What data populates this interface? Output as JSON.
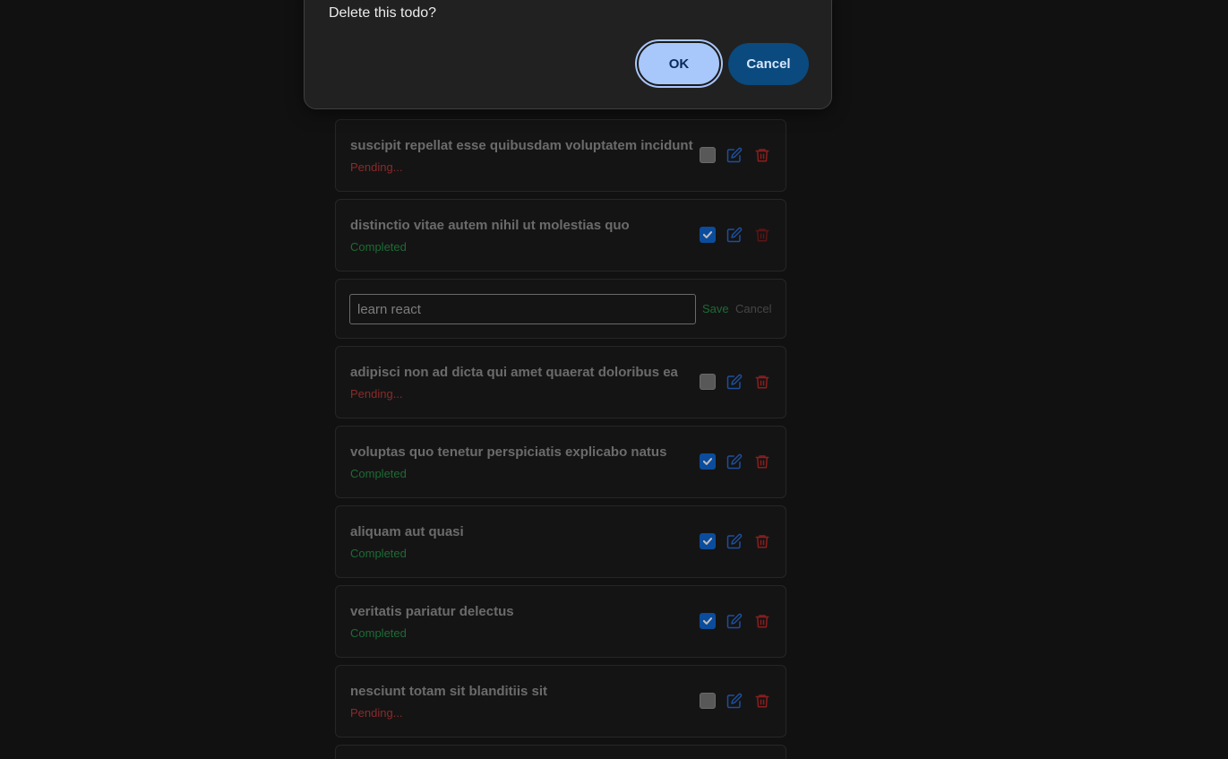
{
  "dialog": {
    "message": "Delete this todo?",
    "ok_label": "OK",
    "cancel_label": "Cancel"
  },
  "colors": {
    "background": "#111111",
    "pending": "#8b2a2a",
    "completed": "#1d6b35",
    "edit_icon": "#1e4f9c",
    "delete_icon": "#8b1e1e",
    "checkbox_checked": "#0b4c9c",
    "dialog_ok": "#a8c7fa",
    "dialog_cancel": "#0a4a7e"
  },
  "icons": {
    "checkbox_checked": "check-icon",
    "edit": "edit-icon",
    "delete": "trash-icon"
  },
  "todos": [
    {
      "title": "suscipit repellat esse quibusdam voluptatem incidunt",
      "status": "Pending...",
      "completed": false
    },
    {
      "title": "distinctio vitae autem nihil ut molestias quo",
      "status": "Completed",
      "completed": true
    },
    {
      "editing": true,
      "value": "learn react",
      "save_label": "Save",
      "cancel_label": "Cancel"
    },
    {
      "title": "adipisci non ad dicta qui amet quaerat doloribus ea",
      "status": "Pending...",
      "completed": false
    },
    {
      "title": "voluptas quo tenetur perspiciatis explicabo natus",
      "status": "Completed",
      "completed": true
    },
    {
      "title": "aliquam aut quasi",
      "status": "Completed",
      "completed": true
    },
    {
      "title": "veritatis pariatur delectus",
      "status": "Completed",
      "completed": true
    },
    {
      "title": "nesciunt totam sit blanditiis sit",
      "status": "Pending...",
      "completed": false
    }
  ]
}
